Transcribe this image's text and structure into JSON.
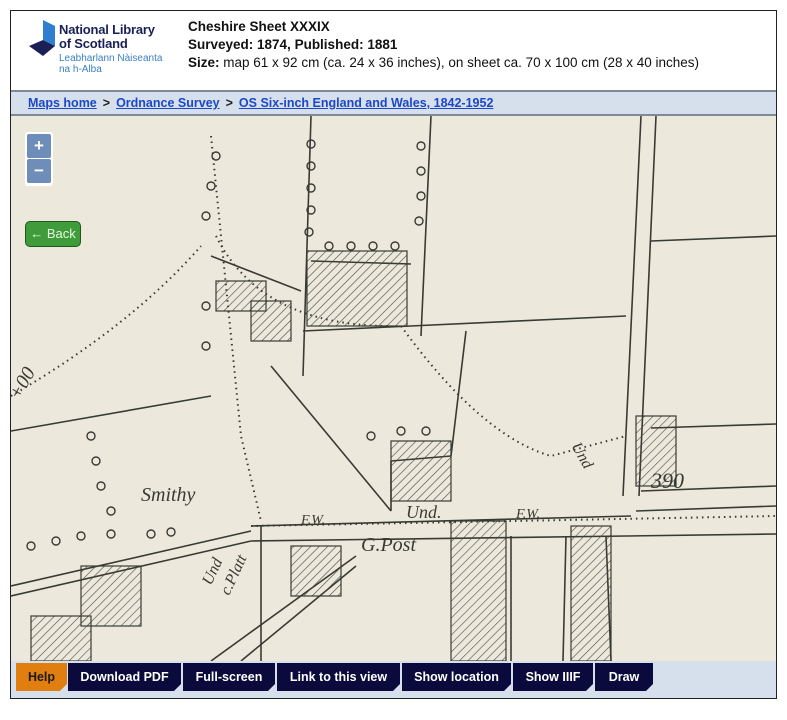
{
  "header": {
    "logo": {
      "name_line1": "National Library",
      "name_line2": "of Scotland",
      "gaelic_line1": "Leabharlann Nàiseanta",
      "gaelic_line2": "na h-Alba",
      "colors": {
        "dark": "#1a2055",
        "blue": "#2f7fd0",
        "light": "#3a7fc4"
      }
    },
    "title": "Cheshire Sheet XXXIX",
    "dates": "Surveyed: 1874, Published: 1881",
    "size_label": "Size:",
    "size_value": " map 61 x 92 cm (ca. 24 x 36 inches), on sheet ca. 70 x 100 cm (28 x 40 inches)"
  },
  "breadcrumb": [
    {
      "label": "Maps home"
    },
    {
      "label": "Ordnance Survey"
    },
    {
      "label": "OS Six-inch England and Wales, 1842-1952"
    }
  ],
  "breadcrumb_separator": ">",
  "map": {
    "zoom_in": "+",
    "zoom_out": "−",
    "back_label": "← Back",
    "labels": {
      "smithy": "Smithy",
      "fw1": "F.W.",
      "und1": "Und.",
      "fw2": "F.W.",
      "und2": "Und",
      "und3": "Und",
      "gpost": "G.Post",
      "plan": "c.Platt",
      "parcel": "390",
      "edge": "+00"
    },
    "colors": {
      "paper": "#ece9dc",
      "ink": "#3a3a34"
    }
  },
  "toolbar": {
    "buttons": [
      {
        "label": "Help"
      },
      {
        "label": "Download PDF"
      },
      {
        "label": "Full-screen"
      },
      {
        "label": "Link to this view"
      },
      {
        "label": "Show location"
      },
      {
        "label": "Show IIIF"
      },
      {
        "label": "Draw"
      }
    ],
    "colors": {
      "help": "#e07f10",
      "button": "#0a0a3c",
      "bar": "#d6e0ec"
    }
  }
}
